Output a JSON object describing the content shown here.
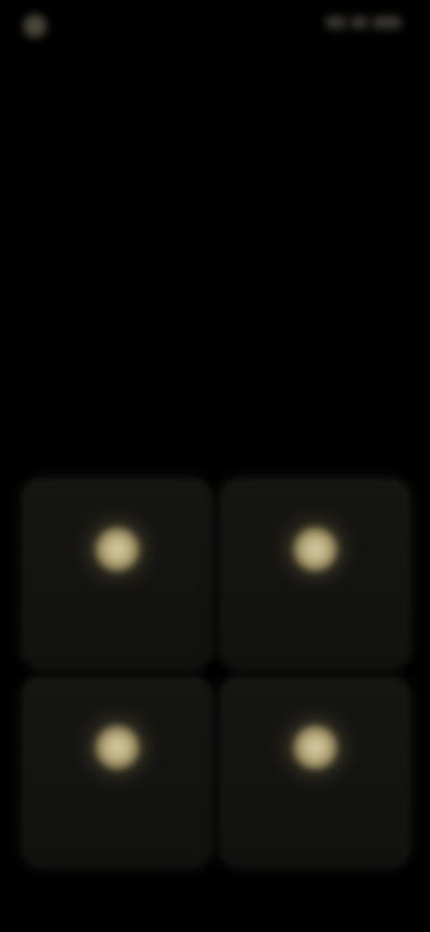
{
  "status_bar": {
    "time": "",
    "indicators": ""
  },
  "headline": "",
  "subtitle": "",
  "cards": [
    {
      "label": "",
      "icon": "glow-orb-icon"
    },
    {
      "label": "",
      "icon": "glow-orb-icon"
    },
    {
      "label": "",
      "icon": "glow-orb-icon"
    },
    {
      "label": "",
      "icon": "glow-orb-icon"
    }
  ],
  "colors": {
    "background": "#000000",
    "card": "#151512",
    "orb": "#c9bd8f",
    "text_primary": "#d9d7d1",
    "text_muted": "#58564f"
  }
}
